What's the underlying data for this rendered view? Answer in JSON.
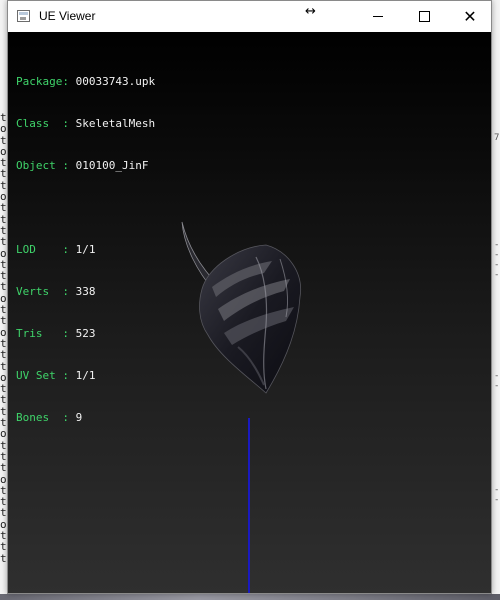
{
  "window": {
    "title": "UE Viewer",
    "resize_glyph": "↔",
    "close_glyph": "✕"
  },
  "info": {
    "package": {
      "label": "Package: ",
      "value": "00033743.upk"
    },
    "class": {
      "label": "Class  : ",
      "value": "SkeletalMesh"
    },
    "object": {
      "label": "Object : ",
      "value": "010100_JinF"
    },
    "lod": {
      "label": "LOD    : ",
      "value": "1/1"
    },
    "verts": {
      "label": "Verts  : ",
      "value": "338"
    },
    "tris": {
      "label": "Tris   : ",
      "value": "523"
    },
    "uvset": {
      "label": "UV Set : ",
      "value": "1/1"
    },
    "bones": {
      "label": "Bones  : ",
      "value": "9"
    }
  },
  "background_console": {
    "left_chars": [
      "t",
      "o",
      "t",
      "o",
      "t",
      "t",
      "t",
      "o",
      "t",
      "t",
      "t",
      "t",
      "o",
      "t",
      "t",
      "t",
      "o",
      "t",
      "t",
      "o",
      "t",
      "t",
      "t",
      "o",
      "t",
      "t",
      "t",
      "t",
      "o",
      "t",
      "t",
      "t",
      "o",
      "t",
      "t",
      "t",
      "o",
      "t",
      "t",
      "t"
    ]
  },
  "colors": {
    "label_green": "#3fd46a",
    "value_white": "#f2f2f2",
    "axis_blue": "#1a1ac0"
  },
  "icons": {
    "app": "app-window-icon",
    "minimize": "minimize-icon",
    "maximize": "maximize-icon",
    "close": "close-icon",
    "resize": "resize-horizontal-icon"
  }
}
